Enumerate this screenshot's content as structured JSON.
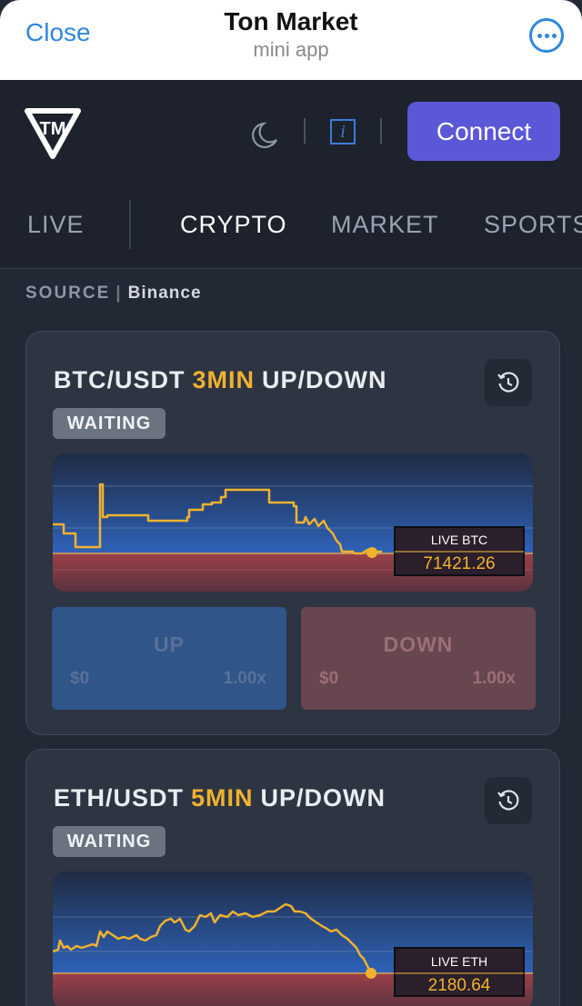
{
  "telegram": {
    "close_label": "Close",
    "title": "Ton Market",
    "subtitle": "mini app",
    "more_icon": "more-icon"
  },
  "header": {
    "logo_text": "TM",
    "theme_icon": "moon-icon",
    "info_icon_glyph": "i",
    "connect_label": "Connect",
    "accent": "#5b58d8"
  },
  "tabs": [
    {
      "label": "LIVE",
      "active": false
    },
    {
      "label": "CRYPTO",
      "active": true
    },
    {
      "label": "MARKET",
      "active": false
    },
    {
      "label": "SPORTS",
      "active": false
    }
  ],
  "source": {
    "label": "SOURCE",
    "value": "Binance"
  },
  "markets": [
    {
      "pair": "BTC/USDT",
      "duration": "3MIN",
      "kind": "UP/DOWN",
      "status": "WAITING",
      "live_label": "LIVE BTC",
      "live_price": "71421.26",
      "up": {
        "label": "UP",
        "amount": "$0",
        "multiplier": "1.00x"
      },
      "down": {
        "label": "DOWN",
        "amount": "$0",
        "multiplier": "1.00x"
      }
    },
    {
      "pair": "ETH/USDT",
      "duration": "5MIN",
      "kind": "UP/DOWN",
      "status": "WAITING",
      "live_label": "LIVE ETH",
      "live_price": "2180.64"
    }
  ],
  "colors": {
    "line": "#f0b22e",
    "up_zone": "#2f62b8",
    "down_zone": "#9a4048"
  }
}
